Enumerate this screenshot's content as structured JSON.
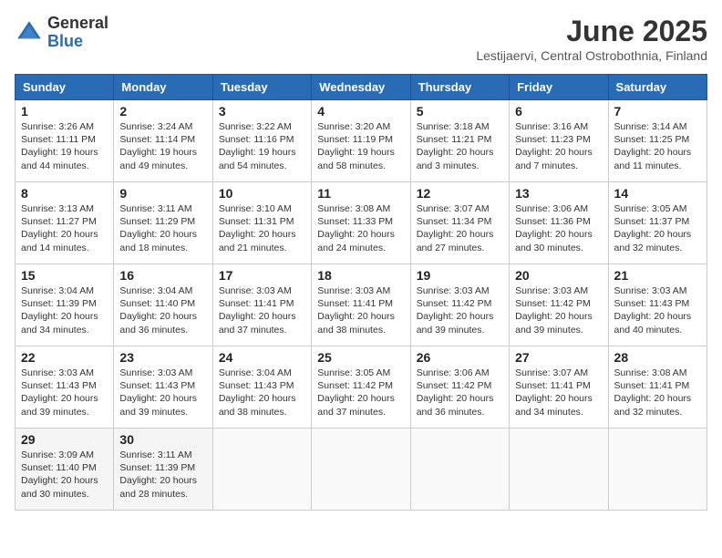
{
  "header": {
    "logo_general": "General",
    "logo_blue": "Blue",
    "month": "June 2025",
    "location": "Lestijaervi, Central Ostrobothnia, Finland"
  },
  "weekdays": [
    "Sunday",
    "Monday",
    "Tuesday",
    "Wednesday",
    "Thursday",
    "Friday",
    "Saturday"
  ],
  "weeks": [
    [
      {
        "day": "1",
        "info": "Sunrise: 3:26 AM\nSunset: 11:11 PM\nDaylight: 19 hours\nand 44 minutes."
      },
      {
        "day": "2",
        "info": "Sunrise: 3:24 AM\nSunset: 11:14 PM\nDaylight: 19 hours\nand 49 minutes."
      },
      {
        "day": "3",
        "info": "Sunrise: 3:22 AM\nSunset: 11:16 PM\nDaylight: 19 hours\nand 54 minutes."
      },
      {
        "day": "4",
        "info": "Sunrise: 3:20 AM\nSunset: 11:19 PM\nDaylight: 19 hours\nand 58 minutes."
      },
      {
        "day": "5",
        "info": "Sunrise: 3:18 AM\nSunset: 11:21 PM\nDaylight: 20 hours\nand 3 minutes."
      },
      {
        "day": "6",
        "info": "Sunrise: 3:16 AM\nSunset: 11:23 PM\nDaylight: 20 hours\nand 7 minutes."
      },
      {
        "day": "7",
        "info": "Sunrise: 3:14 AM\nSunset: 11:25 PM\nDaylight: 20 hours\nand 11 minutes."
      }
    ],
    [
      {
        "day": "8",
        "info": "Sunrise: 3:13 AM\nSunset: 11:27 PM\nDaylight: 20 hours\nand 14 minutes."
      },
      {
        "day": "9",
        "info": "Sunrise: 3:11 AM\nSunset: 11:29 PM\nDaylight: 20 hours\nand 18 minutes."
      },
      {
        "day": "10",
        "info": "Sunrise: 3:10 AM\nSunset: 11:31 PM\nDaylight: 20 hours\nand 21 minutes."
      },
      {
        "day": "11",
        "info": "Sunrise: 3:08 AM\nSunset: 11:33 PM\nDaylight: 20 hours\nand 24 minutes."
      },
      {
        "day": "12",
        "info": "Sunrise: 3:07 AM\nSunset: 11:34 PM\nDaylight: 20 hours\nand 27 minutes."
      },
      {
        "day": "13",
        "info": "Sunrise: 3:06 AM\nSunset: 11:36 PM\nDaylight: 20 hours\nand 30 minutes."
      },
      {
        "day": "14",
        "info": "Sunrise: 3:05 AM\nSunset: 11:37 PM\nDaylight: 20 hours\nand 32 minutes."
      }
    ],
    [
      {
        "day": "15",
        "info": "Sunrise: 3:04 AM\nSunset: 11:39 PM\nDaylight: 20 hours\nand 34 minutes."
      },
      {
        "day": "16",
        "info": "Sunrise: 3:04 AM\nSunset: 11:40 PM\nDaylight: 20 hours\nand 36 minutes."
      },
      {
        "day": "17",
        "info": "Sunrise: 3:03 AM\nSunset: 11:41 PM\nDaylight: 20 hours\nand 37 minutes."
      },
      {
        "day": "18",
        "info": "Sunrise: 3:03 AM\nSunset: 11:41 PM\nDaylight: 20 hours\nand 38 minutes."
      },
      {
        "day": "19",
        "info": "Sunrise: 3:03 AM\nSunset: 11:42 PM\nDaylight: 20 hours\nand 39 minutes."
      },
      {
        "day": "20",
        "info": "Sunrise: 3:03 AM\nSunset: 11:42 PM\nDaylight: 20 hours\nand 39 minutes."
      },
      {
        "day": "21",
        "info": "Sunrise: 3:03 AM\nSunset: 11:43 PM\nDaylight: 20 hours\nand 40 minutes."
      }
    ],
    [
      {
        "day": "22",
        "info": "Sunrise: 3:03 AM\nSunset: 11:43 PM\nDaylight: 20 hours\nand 39 minutes."
      },
      {
        "day": "23",
        "info": "Sunrise: 3:03 AM\nSunset: 11:43 PM\nDaylight: 20 hours\nand 39 minutes."
      },
      {
        "day": "24",
        "info": "Sunrise: 3:04 AM\nSunset: 11:43 PM\nDaylight: 20 hours\nand 38 minutes."
      },
      {
        "day": "25",
        "info": "Sunrise: 3:05 AM\nSunset: 11:42 PM\nDaylight: 20 hours\nand 37 minutes."
      },
      {
        "day": "26",
        "info": "Sunrise: 3:06 AM\nSunset: 11:42 PM\nDaylight: 20 hours\nand 36 minutes."
      },
      {
        "day": "27",
        "info": "Sunrise: 3:07 AM\nSunset: 11:41 PM\nDaylight: 20 hours\nand 34 minutes."
      },
      {
        "day": "28",
        "info": "Sunrise: 3:08 AM\nSunset: 11:41 PM\nDaylight: 20 hours\nand 32 minutes."
      }
    ],
    [
      {
        "day": "29",
        "info": "Sunrise: 3:09 AM\nSunset: 11:40 PM\nDaylight: 20 hours\nand 30 minutes."
      },
      {
        "day": "30",
        "info": "Sunrise: 3:11 AM\nSunset: 11:39 PM\nDaylight: 20 hours\nand 28 minutes."
      },
      {
        "day": "",
        "info": ""
      },
      {
        "day": "",
        "info": ""
      },
      {
        "day": "",
        "info": ""
      },
      {
        "day": "",
        "info": ""
      },
      {
        "day": "",
        "info": ""
      }
    ]
  ]
}
